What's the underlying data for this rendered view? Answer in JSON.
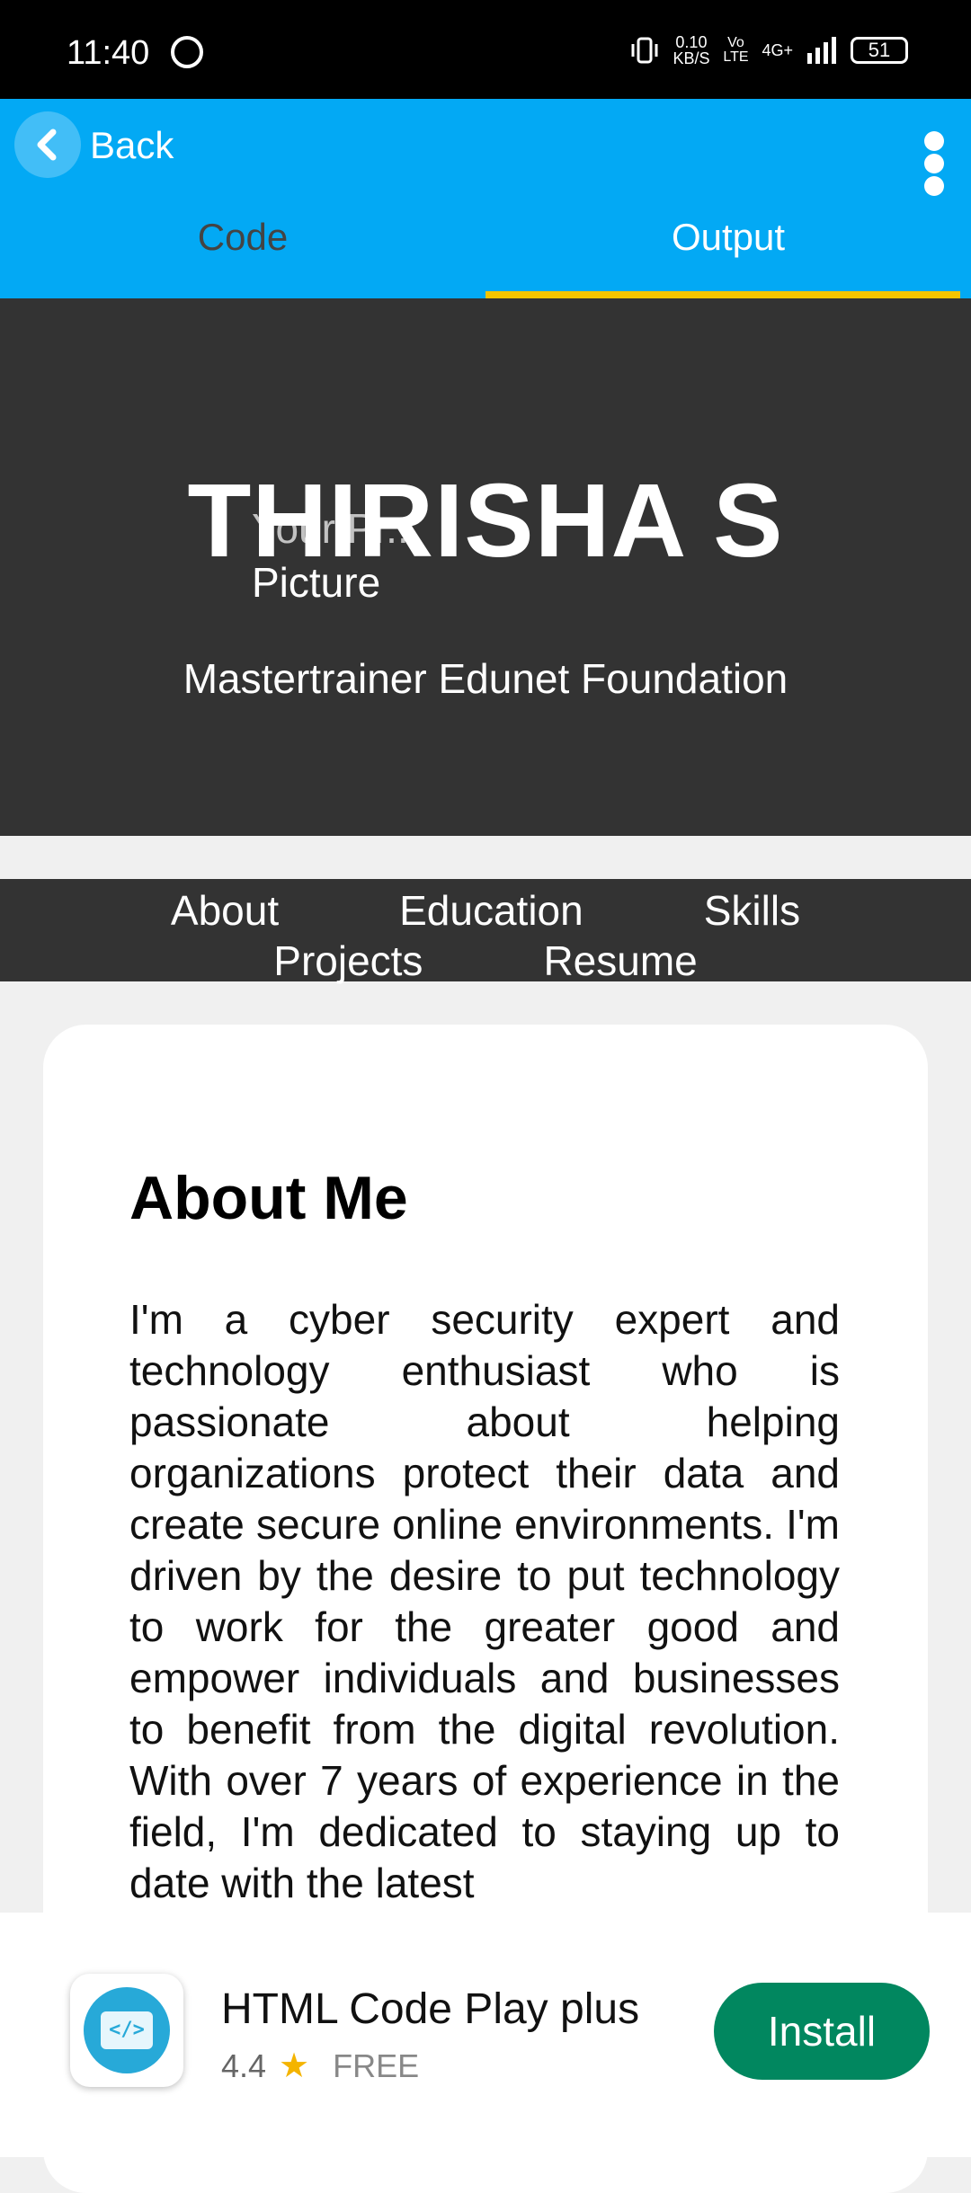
{
  "status_bar": {
    "time": "11:40",
    "net_speed_value": "0.10",
    "net_speed_unit": "KB/S",
    "volte": "Vo LTE",
    "network": "4G+",
    "battery": "51"
  },
  "app_bar": {
    "back_label": "Back",
    "tabs": [
      {
        "label": "Code",
        "selected": false
      },
      {
        "label": "Output",
        "selected": true
      }
    ],
    "accent_color": "#03a9f4",
    "indicator_color": "#f5c400"
  },
  "page": {
    "hero": {
      "name": "THIRISHA S",
      "picture_alt_line1": "Your Pr...",
      "picture_alt_line2": "Picture",
      "subtitle": "Mastertrainer Edunet Foundation"
    },
    "nav": [
      "About",
      "Education",
      "Skills",
      "Projects",
      "Resume"
    ],
    "about": {
      "heading": "About Me",
      "body": "I'm a cyber security expert and technology enthusiast who is passionate about helping organizations protect their data and create secure online environments. I'm driven by the desire to put technology to work for the greater good and empower individuals and businesses to benefit from the digital revolution. With over 7 years of experience in the field, I'm dedicated to staying up to date with the latest"
    }
  },
  "ad": {
    "app_name": "HTML Code Play plus",
    "rating": "4.4",
    "price": "FREE",
    "install_label": "Install",
    "icon": "code-monitor-icon",
    "install_color": "#01875f"
  }
}
